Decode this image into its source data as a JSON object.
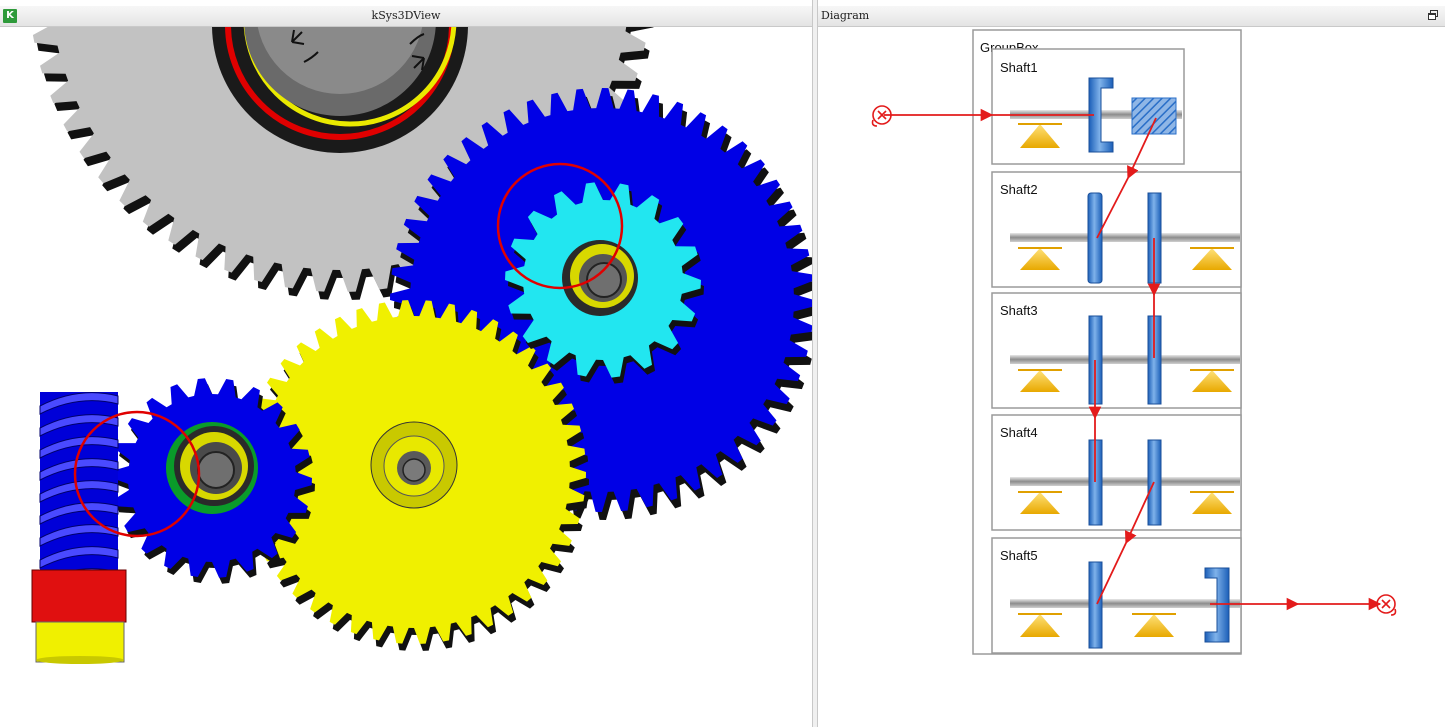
{
  "left_pane": {
    "title": "kSys3DView",
    "logo_letter": "K"
  },
  "right_pane": {
    "title": "Diagram",
    "groupbox_title": "GroupBox",
    "shafts": [
      {
        "label": "Shaft1"
      },
      {
        "label": "Shaft2"
      },
      {
        "label": "Shaft3"
      },
      {
        "label": "Shaft4"
      },
      {
        "label": "Shaft5"
      }
    ]
  },
  "colors": {
    "gear_gray": "#c2c2c2",
    "gear_blue": "#0000e6",
    "gear_cyan": "#22e6f0",
    "gear_yellow": "#f0f000",
    "highlight_red": "#e00000",
    "diagram_blue": "#1f6fd0",
    "bearing_yellow": "#f5c400",
    "flow_red": "#e31b1b"
  },
  "icons": {
    "logo": "k-logo-icon",
    "restore": "restore-window-icon"
  }
}
